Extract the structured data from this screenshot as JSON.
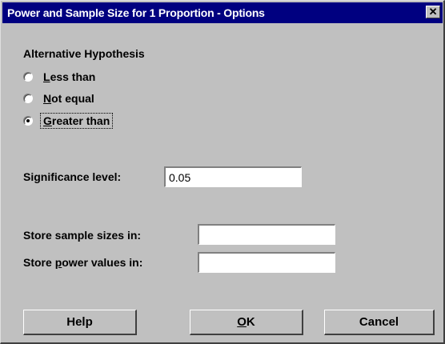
{
  "window": {
    "title": "Power and Sample Size for 1 Proportion - Options",
    "close_glyph": "✕"
  },
  "alternative": {
    "heading": "Alternative Hypothesis",
    "options": [
      {
        "pre": "",
        "ul": "L",
        "post": "ess than",
        "checked": false
      },
      {
        "pre": "",
        "ul": "N",
        "post": "ot equal",
        "checked": false
      },
      {
        "pre": "",
        "ul": "G",
        "post": "reater than",
        "checked": true
      }
    ]
  },
  "significance": {
    "label_pre": "Si",
    "label_ul": "g",
    "label_post": "nificance level:",
    "value": "0.05"
  },
  "store_sample": {
    "label": "Store sample sizes in:",
    "value": ""
  },
  "store_power": {
    "label_pre": "Store ",
    "label_ul": "p",
    "label_post": "ower values in:",
    "value": ""
  },
  "buttons": {
    "help": "Help",
    "ok_ul": "O",
    "ok_post": "K",
    "cancel": "Cancel"
  },
  "colors": {
    "titlebar": "#000080",
    "face": "#c0c0c0"
  },
  "icons": {
    "close": "close-icon",
    "radio": "radio-button-icon"
  }
}
